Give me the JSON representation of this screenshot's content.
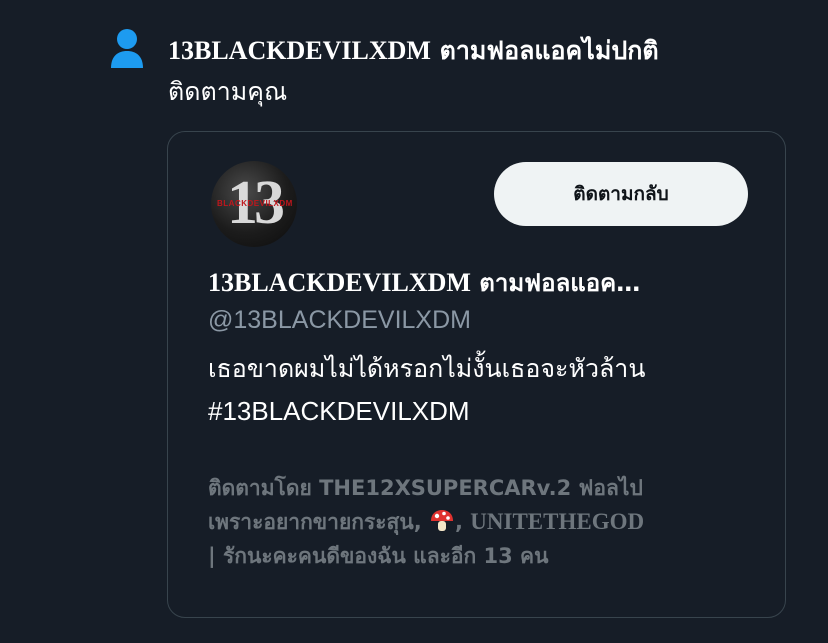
{
  "notification": {
    "icon": "person-icon",
    "accent_color": "#1d9bf0",
    "actor_name": "13BLACKDEVILXDM",
    "action_text": "ตามฟอลแอคไม่ปกติ",
    "line2": "ติดตามคุณ"
  },
  "card": {
    "avatar_text": "13",
    "avatar_band": "BLACKDEVILXDM",
    "follow_back_label": "ติดตามกลับ",
    "display_name": "13BLACKDEVILXDM",
    "display_name_suffix": "ตามฟอลแอค…",
    "handle": "@13BLACKDEVILXDM",
    "bio_line1": "เธอขาดผมไม่ได้หรอกไม่งั้นเธอจะหัวล้าน",
    "bio_line2": "#13BLACKDEVILXDM",
    "followed_by_prefix": "ติดตามโดย",
    "followed_by_user1": "THE12XSUPERCARv.2 ฟอลไป",
    "followed_by_user1_cont": "เพราะอยากขายกระสุน,",
    "followed_by_user2": "UNITETHEGOD",
    "followed_by_user2_cont": "| รักนะคะคนดีของฉัน",
    "followed_by_more": "และอีก 13 คน",
    "emoji_icon": "mushroom-icon"
  }
}
